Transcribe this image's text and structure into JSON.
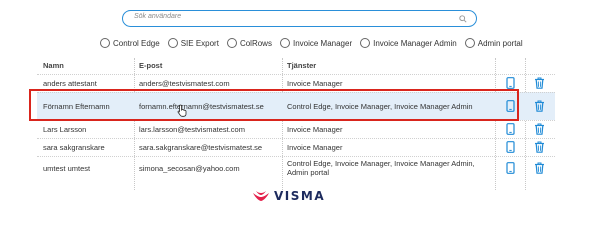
{
  "search": {
    "placeholder": "Sök användare"
  },
  "filters": [
    {
      "label": "Control Edge"
    },
    {
      "label": "SIE Export"
    },
    {
      "label": "ColRows"
    },
    {
      "label": "Invoice Manager"
    },
    {
      "label": "Invoice Manager Admin"
    },
    {
      "label": "Admin portal"
    }
  ],
  "table": {
    "headers": {
      "name": "Namn",
      "email": "E-post",
      "services": "Tjänster"
    },
    "rows": [
      {
        "name": "anders attestant",
        "email": "anders@testvismatest.com",
        "services": "Invoice Manager"
      },
      {
        "name": "Förnamn Efternamn",
        "email": "fornamn.efternamn@testvismatest.se",
        "services": "Control Edge, Invoice Manager, Invoice Manager Admin"
      },
      {
        "name": "Lars Larsson",
        "email": "lars.larsson@testvismatest.com",
        "services": "Invoice Manager"
      },
      {
        "name": "sara sakgranskare",
        "email": "sara.sakgranskare@testvismatest.se",
        "services": "Invoice Manager"
      },
      {
        "name": "umtest umtest",
        "email": "simona_secosan@yahoo.com",
        "services": "Control Edge, Invoice Manager, Invoice Manager Admin, Admin portal"
      }
    ]
  },
  "logo": {
    "text": "VISMA"
  },
  "colors": {
    "accent": "#2a8fd9",
    "highlight_row": "#e3eef9",
    "highlight_border": "#d9251d",
    "logo_mark": "#e4204b",
    "logo_text": "#1d2b5e"
  },
  "icons": {
    "edit": "phone-icon",
    "delete": "trash-icon",
    "search": "search-icon"
  }
}
